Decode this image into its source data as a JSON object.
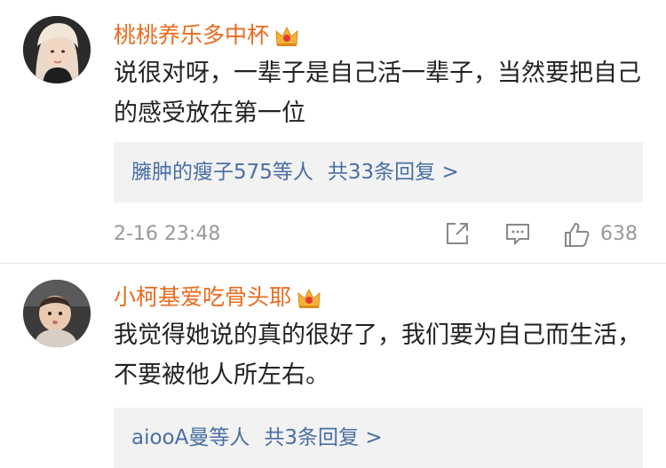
{
  "comments": [
    {
      "username": "桃桃养乐多中杯",
      "text": "说很对呀，一辈子是自己活一辈子，当然要把自己的感受放在第一位",
      "reply_users": "臃肿的瘦子575等人",
      "reply_count": "共33条回复 >",
      "timestamp": "2-16 23:48",
      "likes": "638"
    },
    {
      "username": "小柯基爱吃骨头耶",
      "text": "我觉得她说的真的很好了，我们要为自己而生活，不要被他人所左右。",
      "reply_users": "aiooA曼等人",
      "reply_count": "共3条回复 >"
    }
  ],
  "icons": {
    "badge": "crown-icon",
    "share": "share-icon",
    "comment": "comment-icon",
    "like": "thumbs-up-icon"
  },
  "colors": {
    "username": "#e86b1e",
    "link": "#4a6fa5",
    "meta": "#999999",
    "reply_bg": "#f2f2f2"
  }
}
